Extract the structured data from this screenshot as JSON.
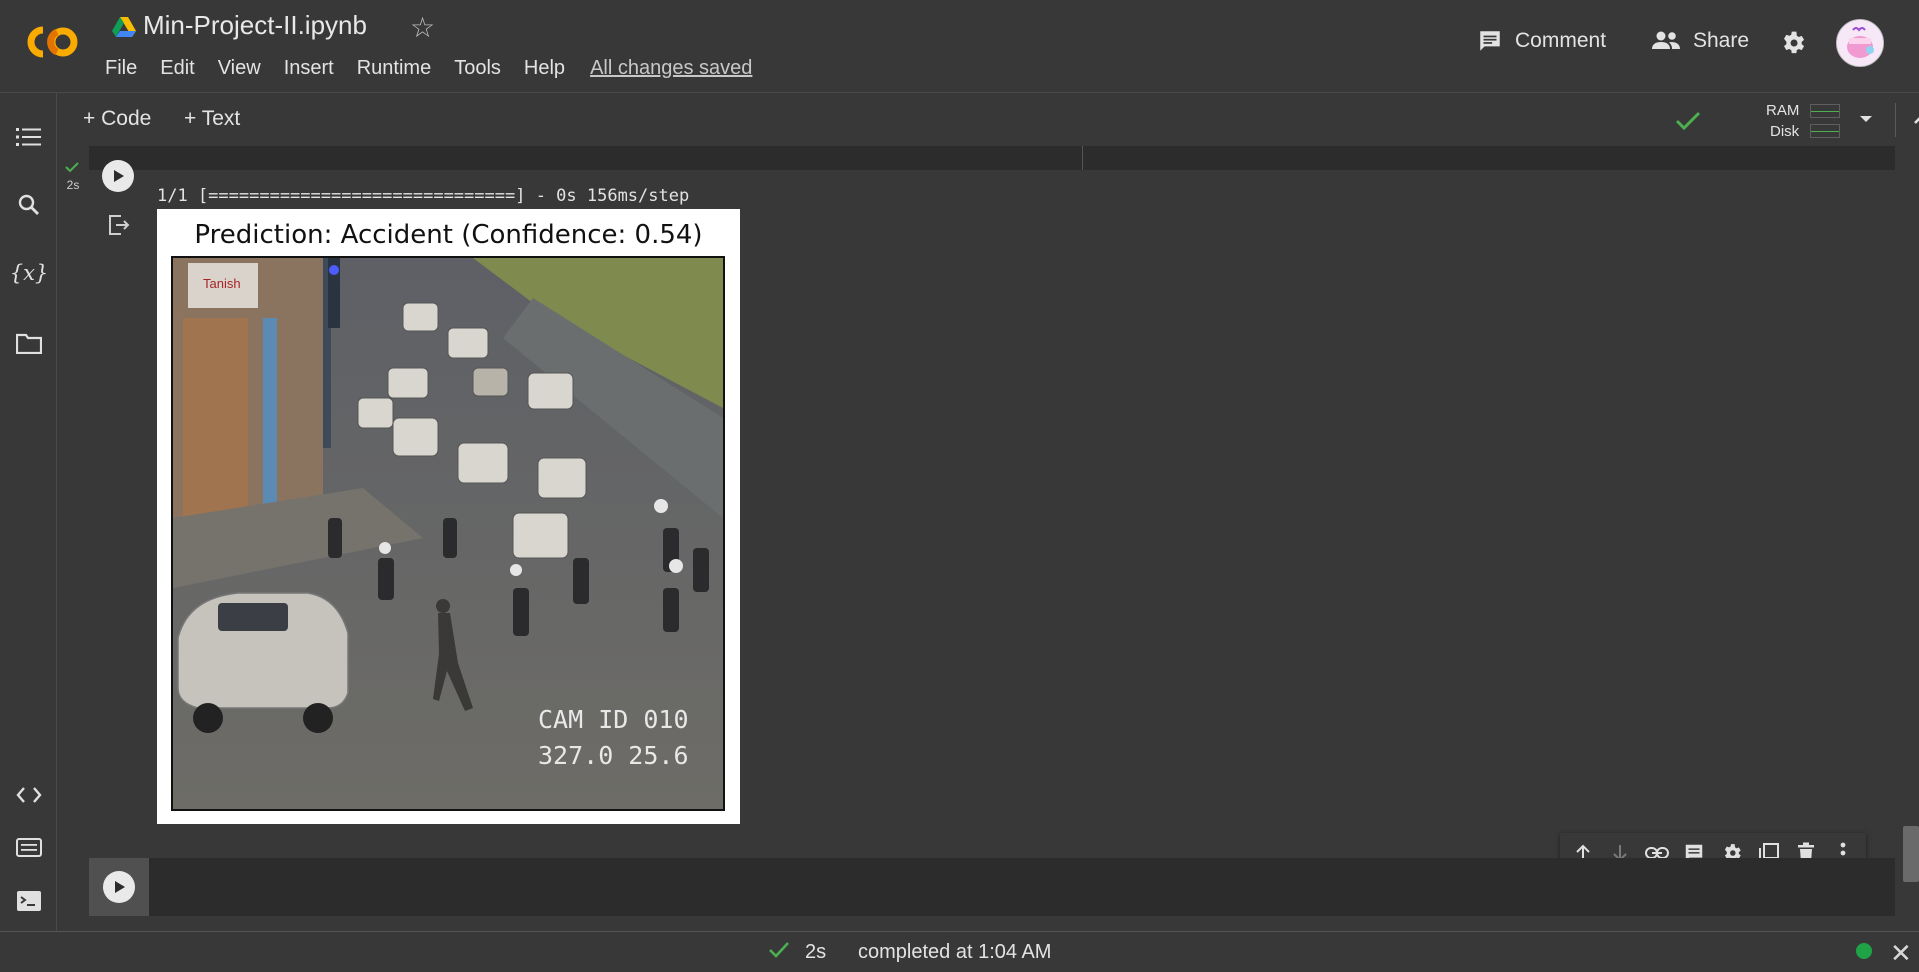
{
  "header": {
    "logo_text": "CO",
    "notebook_title": "Min-Project-II.ipynb",
    "menu": [
      "File",
      "Edit",
      "View",
      "Insert",
      "Runtime",
      "Tools",
      "Help"
    ],
    "save_status": "All changes saved",
    "comment_label": "Comment",
    "share_label": "Share"
  },
  "toolbar": {
    "add_code_label": "+ Code",
    "add_text_label": "+ Text",
    "ram_label": "RAM",
    "disk_label": "Disk"
  },
  "sidebar": {
    "items": [
      "table-of-contents-icon",
      "search-icon",
      "variables-icon",
      "files-icon",
      "code-snippets-icon",
      "command-palette-icon",
      "terminal-icon"
    ]
  },
  "cell": {
    "exec_time": "2s",
    "console_output": "1/1 [==============================] - 0s 156ms/step",
    "figure_title": "Prediction: Accident (Confidence: 0.54)",
    "camera_overlay_line1": "CAM ID 010",
    "camera_overlay_line2": "327.0 25.6",
    "billboard_text": "Tanish"
  },
  "status_bar": {
    "duration": "2s",
    "message": "completed at 1:04 AM",
    "connection_color": "#1ea446"
  },
  "colors": {
    "background": "#383838",
    "cell_background": "#2c2c2c",
    "logo_orange": "#f9ab00",
    "check_green": "#4caf50"
  }
}
